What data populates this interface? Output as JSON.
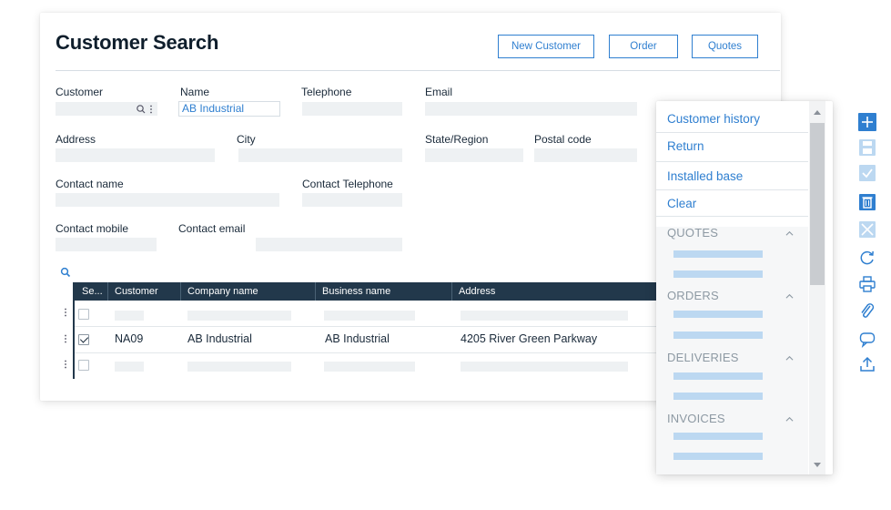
{
  "page": {
    "title": "Customer Search",
    "buttons": {
      "new_customer": "New Customer",
      "order": "Order",
      "quotes": "Quotes"
    }
  },
  "form": {
    "customer_label": "Customer",
    "name_label": "Name",
    "name_value": "AB Industrial",
    "telephone_label": "Telephone",
    "email_label": "Email",
    "address_label": "Address",
    "city_label": "City",
    "state_label": "State/Region",
    "postal_label": "Postal code",
    "contact_name_label": "Contact name",
    "contact_telephone_label": "Contact Telephone",
    "contact_mobile_label": "Contact mobile",
    "contact_email_label": "Contact email"
  },
  "table": {
    "columns": [
      "Se...",
      "Customer",
      "Company name",
      "Business name",
      "Address"
    ],
    "selected_row": {
      "customer": "NA09",
      "company": "AB Industrial",
      "business": "AB Industrial",
      "address": "4205 River Green Parkway"
    }
  },
  "panel": {
    "links": [
      "Customer history",
      "Return",
      "Installed base",
      "Clear"
    ],
    "sections": [
      "QUOTES",
      "ORDERS",
      "DELIVERIES",
      "INVOICES"
    ]
  },
  "colors": {
    "accent": "#2f7fd0",
    "table_header": "#22384b",
    "placeholder": "#eef1f3",
    "panel_bar": "#bcd8f1"
  },
  "icons": {
    "toolbar": [
      "plus-icon",
      "save-icon",
      "check-icon",
      "trash-icon",
      "close-icon",
      "refresh-icon",
      "print-icon",
      "attach-icon",
      "comment-icon",
      "upload-icon"
    ]
  }
}
